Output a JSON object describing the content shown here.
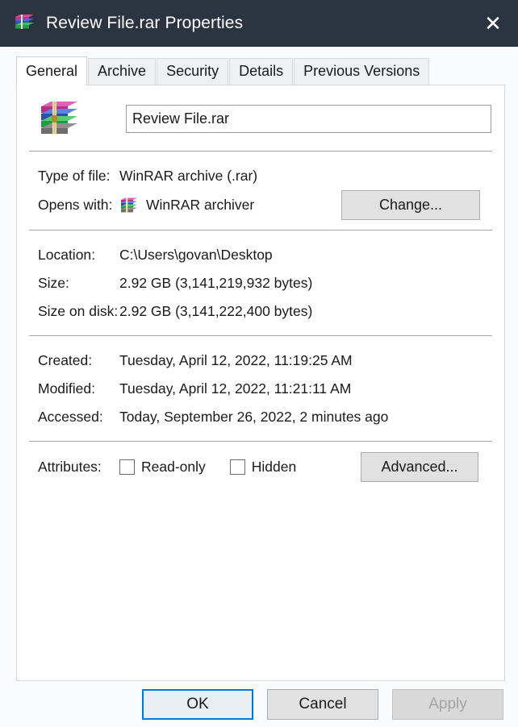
{
  "window": {
    "title": "Review File.rar Properties",
    "icon": "winrar-icon",
    "close_label": "✕",
    "titlebar_color": "#2b3441"
  },
  "tabs": [
    {
      "label": "General",
      "active": true
    },
    {
      "label": "Archive",
      "active": false
    },
    {
      "label": "Security",
      "active": false
    },
    {
      "label": "Details",
      "active": false
    },
    {
      "label": "Previous Versions",
      "active": false
    }
  ],
  "general": {
    "filename": "Review File.rar",
    "type_of_file": {
      "label": "Type of file:",
      "value": "WinRAR archive (.rar)"
    },
    "opens_with": {
      "label": "Opens with:",
      "value": "WinRAR archiver",
      "button": "Change..."
    },
    "location": {
      "label": "Location:",
      "value": "C:\\Users\\govan\\Desktop"
    },
    "size": {
      "label": "Size:",
      "value": "2.92 GB (3,141,219,932 bytes)"
    },
    "size_on_disk": {
      "label": "Size on disk:",
      "value": "2.92 GB (3,141,222,400 bytes)"
    },
    "created": {
      "label": "Created:",
      "value": "Tuesday, April 12, 2022, 11:19:25 AM"
    },
    "modified": {
      "label": "Modified:",
      "value": "Tuesday, April 12, 2022, 11:21:11 AM"
    },
    "accessed": {
      "label": "Accessed:",
      "value": "Today, September 26, 2022, 2 minutes ago"
    },
    "attributes": {
      "label": "Attributes:",
      "read_only": {
        "label": "Read-only",
        "checked": false
      },
      "hidden": {
        "label": "Hidden",
        "checked": false
      },
      "button": "Advanced..."
    }
  },
  "footer": {
    "ok": "OK",
    "cancel": "Cancel",
    "apply": "Apply",
    "focus_color": "#0078d7"
  }
}
